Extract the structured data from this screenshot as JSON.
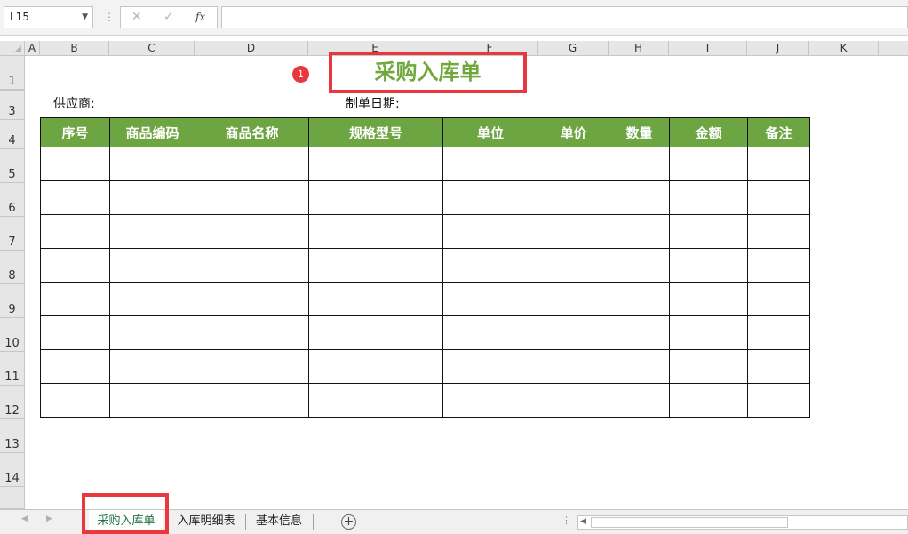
{
  "formula_bar": {
    "name_box": "L15",
    "cancel_icon": "✕",
    "enter_icon": "✓",
    "fx_label": "fx",
    "formula_value": ""
  },
  "column_headers": [
    "A",
    "B",
    "C",
    "D",
    "E",
    "F",
    "G",
    "H",
    "I",
    "J",
    "K"
  ],
  "row_headers": [
    "1",
    "3",
    "4",
    "5",
    "6",
    "7",
    "8",
    "9",
    "10",
    "11",
    "12",
    "13",
    "14"
  ],
  "sheet": {
    "title": "采购入库单",
    "callout_number": "1",
    "supplier_label": "供应商:",
    "date_label": "制单日期:",
    "table_headers": [
      "序号",
      "商品编码",
      "商品名称",
      "规格型号",
      "单位",
      "单价",
      "数量",
      "金额",
      "备注"
    ],
    "body_row_count": 8
  },
  "tabs": [
    {
      "label": "采购入库单",
      "active": true
    },
    {
      "label": "入库明细表",
      "active": false
    },
    {
      "label": "基本信息",
      "active": false
    }
  ],
  "colors": {
    "header_green": "#6ea543",
    "title_green": "#70a83b",
    "highlight_red": "#e8373d",
    "active_tab": "#217346"
  }
}
